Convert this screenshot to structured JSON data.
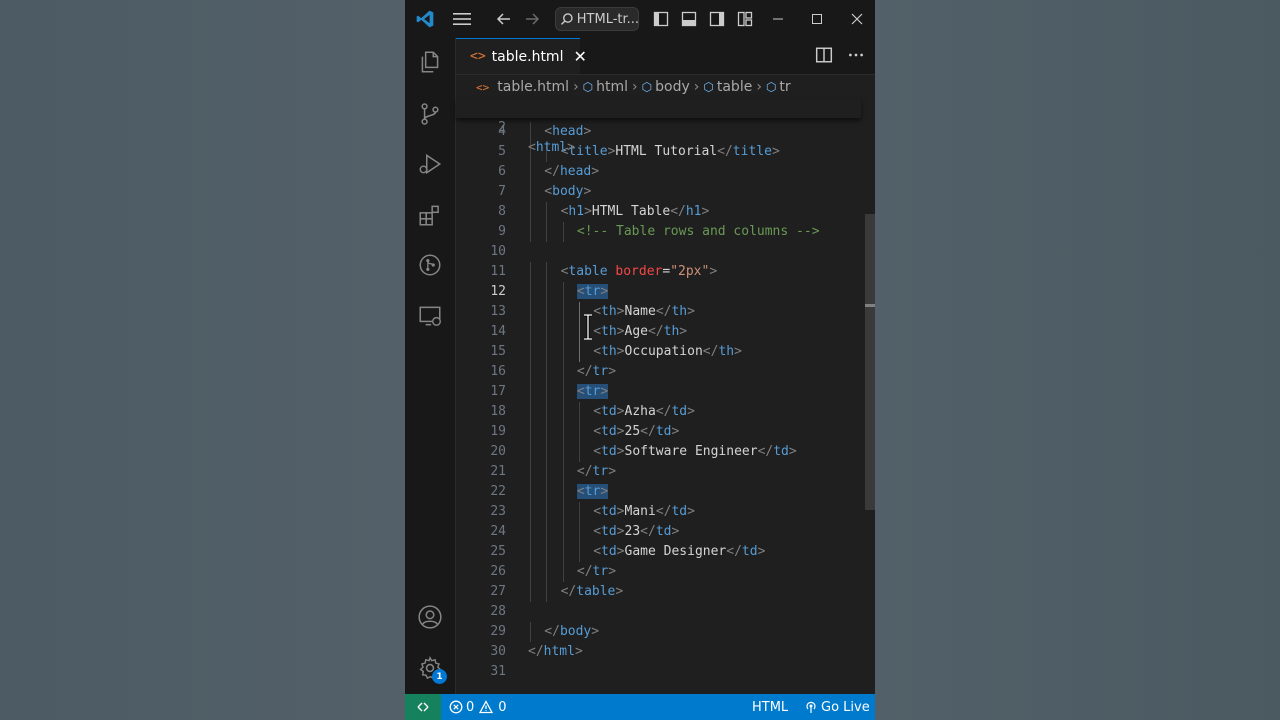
{
  "titlebar": {
    "search_text": "HTML-tr..."
  },
  "tab": {
    "label": "table.html",
    "close": "✕"
  },
  "breadcrumb": {
    "file": "table.html",
    "items": [
      "html",
      "body",
      "table",
      "tr"
    ]
  },
  "editor": {
    "sticky_line": {
      "num": "2",
      "text": "<html>"
    },
    "active_line": "12",
    "lines": [
      {
        "num": "4",
        "indent": 1,
        "text": "<head>"
      },
      {
        "num": "5",
        "indent": 2,
        "text": "<title>HTML Tutorial</title>"
      },
      {
        "num": "6",
        "indent": 1,
        "text": "</head>"
      },
      {
        "num": "7",
        "indent": 1,
        "text": "<body>"
      },
      {
        "num": "8",
        "indent": 2,
        "text": "<h1>HTML Table</h1>"
      },
      {
        "num": "9",
        "indent": 3,
        "text": "<!-- Table rows and columns -->"
      },
      {
        "num": "10",
        "indent": 0,
        "text": ""
      },
      {
        "num": "11",
        "indent": 2,
        "text": "<table border=\"2px\">"
      },
      {
        "num": "12",
        "indent": 3,
        "text": "<tr>"
      },
      {
        "num": "13",
        "indent": 4,
        "text": "<th>Name</th>"
      },
      {
        "num": "14",
        "indent": 4,
        "text": "<th>Age</th>"
      },
      {
        "num": "15",
        "indent": 4,
        "text": "<th>Occupation</th>"
      },
      {
        "num": "16",
        "indent": 3,
        "text": "</tr>"
      },
      {
        "num": "17",
        "indent": 3,
        "text": "<tr>"
      },
      {
        "num": "18",
        "indent": 4,
        "text": "<td>Azha</td>"
      },
      {
        "num": "19",
        "indent": 4,
        "text": "<td>25</td>"
      },
      {
        "num": "20",
        "indent": 4,
        "text": "<td>Software Engineer</td>"
      },
      {
        "num": "21",
        "indent": 3,
        "text": "</tr>"
      },
      {
        "num": "22",
        "indent": 3,
        "text": "<tr>"
      },
      {
        "num": "23",
        "indent": 4,
        "text": "<td>Mani</td>"
      },
      {
        "num": "24",
        "indent": 4,
        "text": "<td>23</td>"
      },
      {
        "num": "25",
        "indent": 4,
        "text": "<td>Game Designer</td>"
      },
      {
        "num": "26",
        "indent": 3,
        "text": "</tr>"
      },
      {
        "num": "27",
        "indent": 2,
        "text": "</table>"
      },
      {
        "num": "28",
        "indent": 0,
        "text": ""
      },
      {
        "num": "29",
        "indent": 1,
        "text": "</body>"
      },
      {
        "num": "30",
        "indent": 0,
        "text": "</html>"
      },
      {
        "num": "31",
        "indent": 0,
        "text": ""
      }
    ]
  },
  "statusbar": {
    "errors": "0",
    "warnings": "0",
    "language": "HTML",
    "golive": "Go Live"
  },
  "activity": {
    "settings_badge": "1"
  }
}
